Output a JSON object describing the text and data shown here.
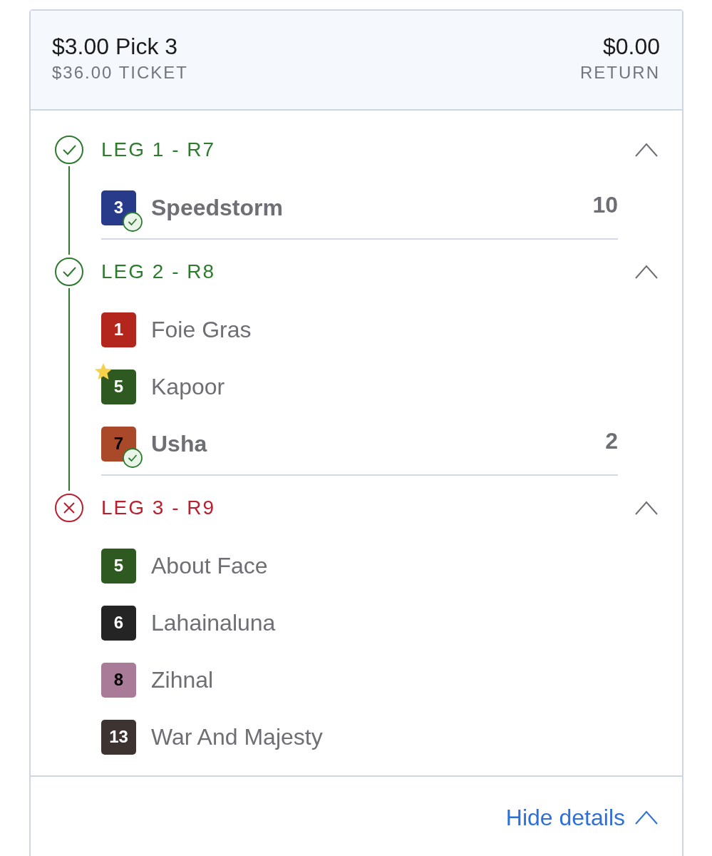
{
  "ticket": {
    "title": "$3.00 Pick 3",
    "cost": "$36.00 TICKET",
    "amount": "$0.00",
    "amount_label": "RETURN"
  },
  "legs": [
    {
      "label": "LEG 1 - R7",
      "won": true,
      "expanded": true,
      "runners": [
        {
          "number": "3",
          "name": "Speedstorm",
          "color": "#283b8b",
          "dark_number": false,
          "favorite": false,
          "winner": true,
          "result": "10"
        }
      ]
    },
    {
      "label": "LEG 2 - R8",
      "won": true,
      "expanded": true,
      "runners": [
        {
          "number": "1",
          "name": "Foie Gras",
          "color": "#b3261e",
          "dark_number": false,
          "favorite": false,
          "winner": false
        },
        {
          "number": "5",
          "name": "Kapoor",
          "color": "#2e5a22",
          "dark_number": false,
          "favorite": true,
          "winner": false
        },
        {
          "number": "7",
          "name": "Usha",
          "color": "#a9492a",
          "dark_number": true,
          "favorite": false,
          "winner": true,
          "result": "2"
        }
      ]
    },
    {
      "label": "LEG 3 - R9",
      "won": false,
      "expanded": true,
      "runners": [
        {
          "number": "5",
          "name": "About Face",
          "color": "#2e5a22",
          "dark_number": false,
          "favorite": false,
          "winner": false
        },
        {
          "number": "6",
          "name": "Lahainaluna",
          "color": "#242424",
          "dark_number": false,
          "favorite": false,
          "winner": false
        },
        {
          "number": "8",
          "name": "Zihnal",
          "color": "#a97b98",
          "dark_number": true,
          "favorite": false,
          "winner": false
        },
        {
          "number": "13",
          "name": "War And Majesty",
          "color": "#3d3432",
          "dark_number": false,
          "favorite": false,
          "winner": false
        }
      ]
    }
  ],
  "footer": {
    "label": "Hide details",
    "expanded": true
  }
}
